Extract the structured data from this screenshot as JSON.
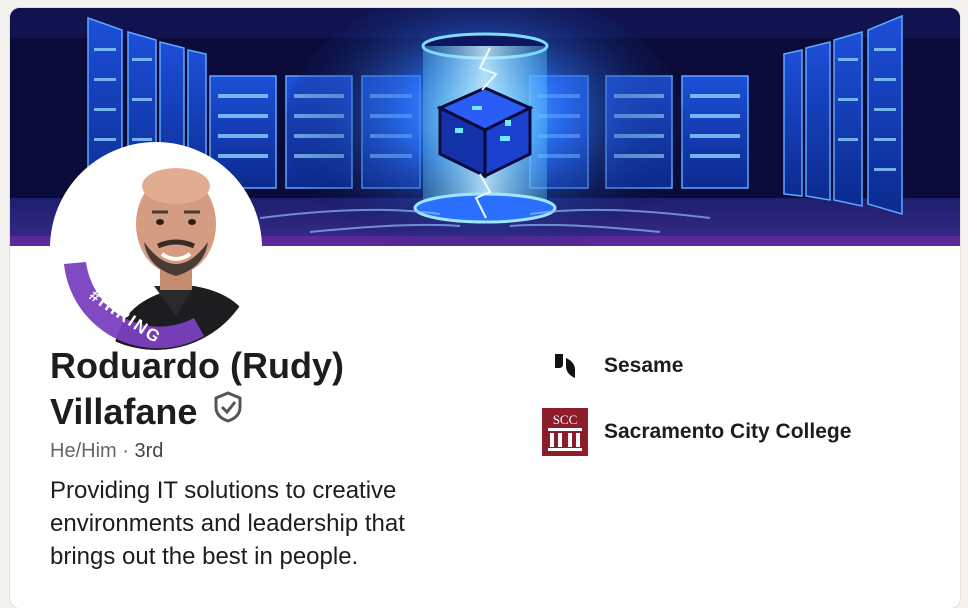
{
  "profile": {
    "name_line1": "Roduardo (Rudy)",
    "name_line2": "Villafane",
    "pronouns": "He/Him",
    "separator": "·",
    "connection_degree": "3rd",
    "headline": "Providing IT solutions to creative environments and leadership that brings out the best in people.",
    "photo_frame_text": "#HIRING",
    "verified_icon": "verified-shield-icon"
  },
  "experience": [
    {
      "label": "Sesame",
      "icon": "sesame-logo"
    },
    {
      "label": "Sacramento City College",
      "icon": "scc-logo",
      "logo_text": "SCC"
    }
  ],
  "colors": {
    "banner_background": "#0a0b3a",
    "banner_glow": "#2f7bff",
    "hiring_frame": "#7a3fbf",
    "scc_maroon": "#8c1d2b",
    "text_primary": "#1d1d1d",
    "text_secondary": "#666666"
  }
}
